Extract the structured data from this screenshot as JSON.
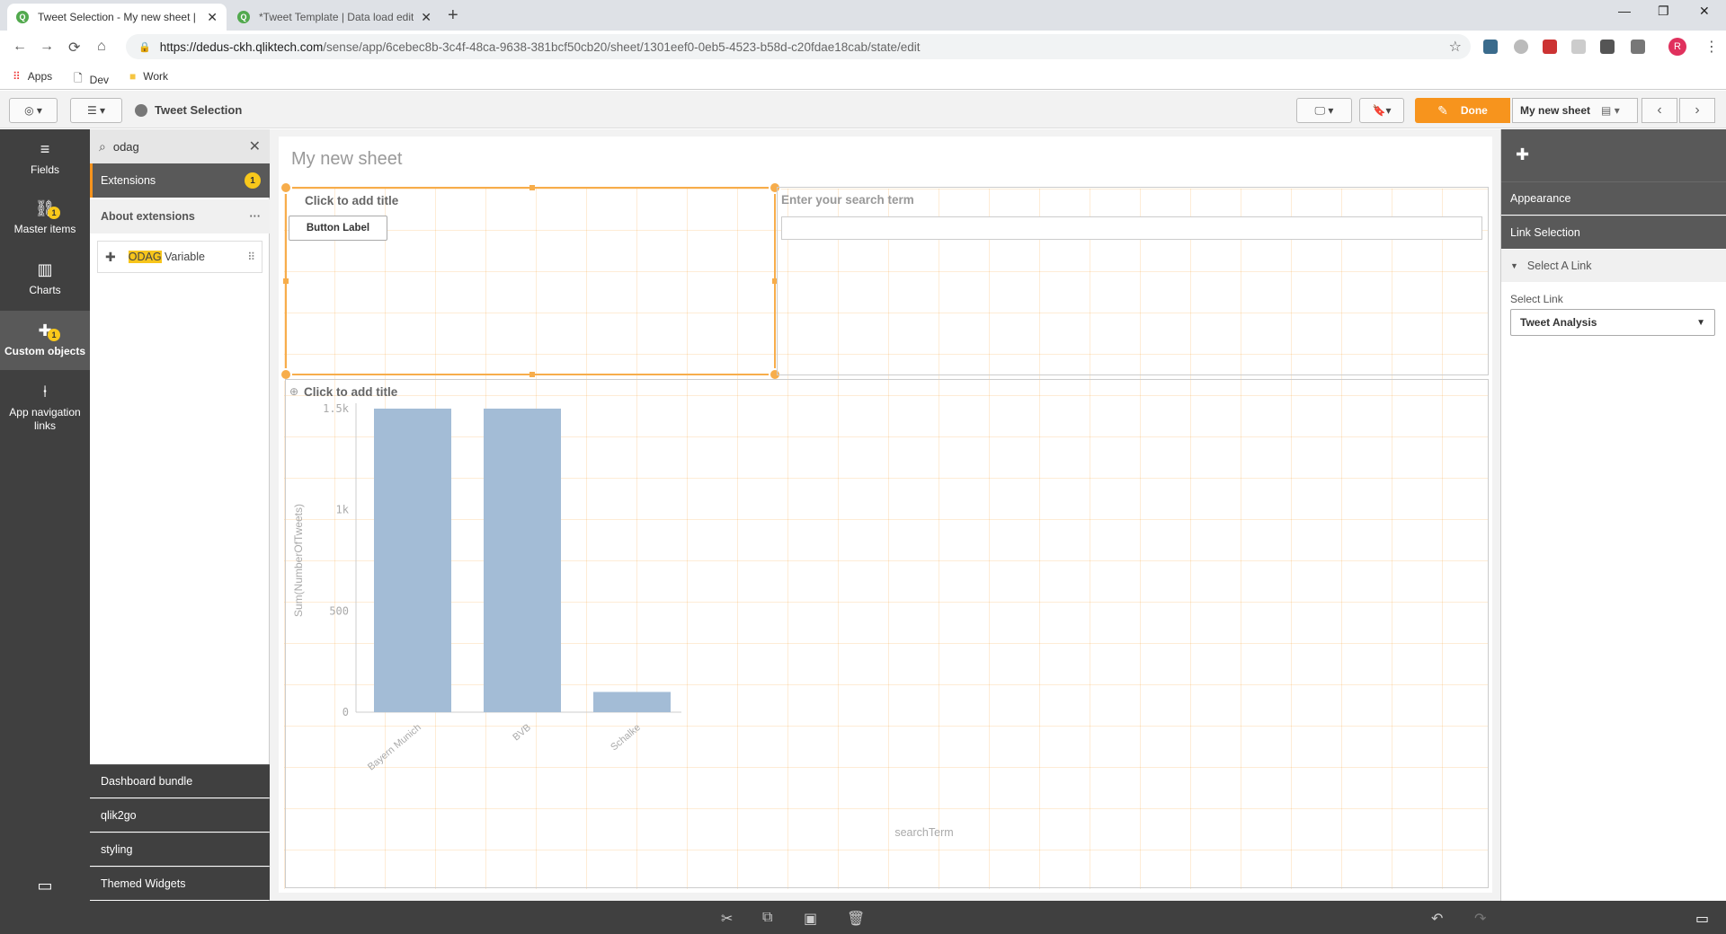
{
  "browser": {
    "tabs": [
      {
        "title": "Tweet Selection - My new sheet |",
        "active": true
      },
      {
        "title": "*Tweet Template | Data load edit",
        "active": false
      }
    ],
    "url_host": "https://dedus-ckh.qliktech.com",
    "url_path": "/sense/app/6cebec8b-3c4f-48ca-9638-381bcf50cb20/sheet/1301eef0-0eb5-4523-b58d-c20fdae18cab/state/edit",
    "profile_initial": "R",
    "bookmarks": [
      "Apps",
      "Dev",
      "Work"
    ]
  },
  "toolbar": {
    "app_title": "Tweet Selection",
    "done_label": "Done",
    "sheet_name": "My new sheet"
  },
  "rail": [
    {
      "label": "Fields",
      "icon": "database-icon"
    },
    {
      "label": "Master items",
      "icon": "link-icon",
      "badge": "1"
    },
    {
      "label": "Charts",
      "icon": "bar-chart-icon"
    },
    {
      "label": "Custom objects",
      "icon": "puzzle-icon",
      "badge": "1",
      "active": true
    },
    {
      "label": "App navigation links",
      "icon": "signpost-icon"
    }
  ],
  "assets": {
    "search_value": "odag",
    "extensions_label": "Extensions",
    "extensions_count": "1",
    "about_label": "About extensions",
    "item_highlight": "ODAG",
    "item_rest": " Variable",
    "bundles": [
      "Dashboard bundle",
      "qlik2go",
      "styling",
      "Themed Widgets"
    ]
  },
  "sheet": {
    "title": "My new sheet",
    "button_object_title": "Click to add title",
    "button_label": "Button Label",
    "search_label": "Enter your search term",
    "chart_object_title": "Click to add title"
  },
  "chart_data": {
    "type": "bar",
    "categories": [
      "Bayern Munich",
      "BVB",
      "Schalke"
    ],
    "values": [
      1500,
      1500,
      100
    ],
    "xlabel": "searchTerm",
    "ylabel": "Sum(NumberOfTweets)",
    "ylim": [
      0,
      1500
    ],
    "yticks": [
      0,
      500,
      1000,
      1500
    ],
    "ytick_labels": [
      "0",
      "500",
      "1k",
      "1.5k"
    ],
    "color": "#a3bcd6"
  },
  "props": {
    "appearance": "Appearance",
    "link_selection": "Link Selection",
    "select_a_link": "Select A Link",
    "select_link_label": "Select Link",
    "select_link_value": "Tweet Analysis"
  }
}
